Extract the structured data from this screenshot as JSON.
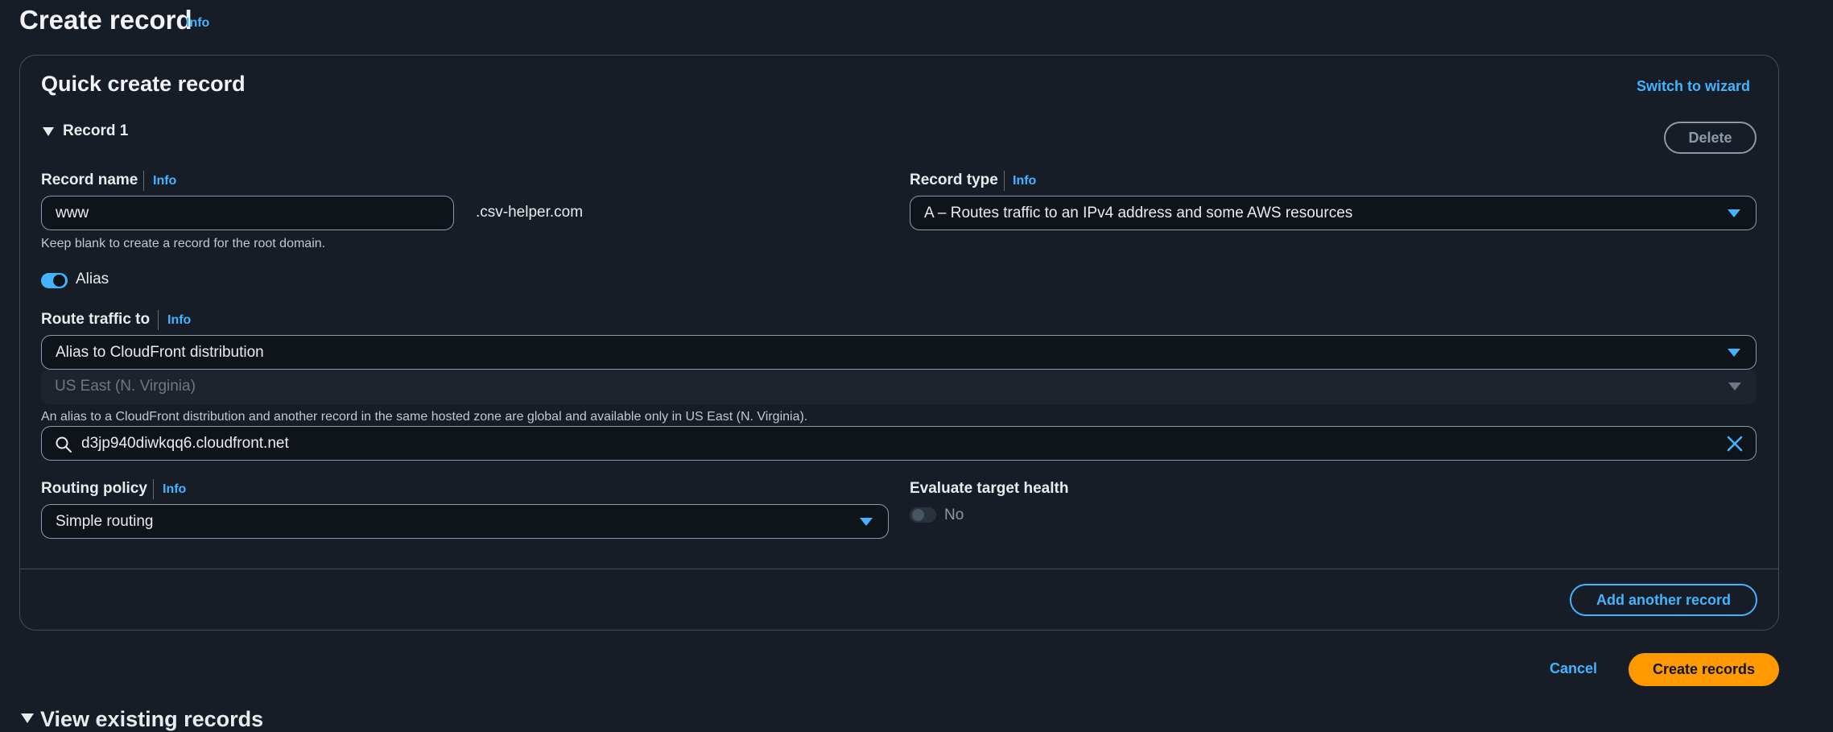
{
  "page": {
    "title": "Create record",
    "info": "Info"
  },
  "panel": {
    "title": "Quick create record",
    "switch_wizard": "Switch to wizard",
    "record_label": "Record 1",
    "delete": "Delete"
  },
  "record_name": {
    "label": "Record name",
    "info": "Info",
    "value": "www",
    "suffix": ".csv-helper.com",
    "hint": "Keep blank to create a record for the root domain."
  },
  "record_type": {
    "label": "Record type",
    "info": "Info",
    "value": "A – Routes traffic to an IPv4 address and some AWS resources"
  },
  "alias": {
    "label": "Alias",
    "enabled": true
  },
  "route_traffic": {
    "label": "Route traffic to",
    "info": "Info",
    "value": "Alias to CloudFront distribution",
    "region": "US East (N. Virginia)",
    "hint": "An alias to a CloudFront distribution and another record in the same hosted zone are global and available only in US East (N. Virginia).",
    "search_value": "d3jp940diwkqq6.cloudfront.net"
  },
  "routing_policy": {
    "label": "Routing policy",
    "info": "Info",
    "value": "Simple routing"
  },
  "evaluate_health": {
    "label": "Evaluate target health",
    "value": "No",
    "enabled": false
  },
  "actions": {
    "add_another": "Add another record",
    "cancel": "Cancel",
    "create": "Create records"
  },
  "existing": {
    "label": "View existing records"
  },
  "colors": {
    "accent": "#42b4ff",
    "primary_button": "#ff9900",
    "background": "#161d26"
  }
}
